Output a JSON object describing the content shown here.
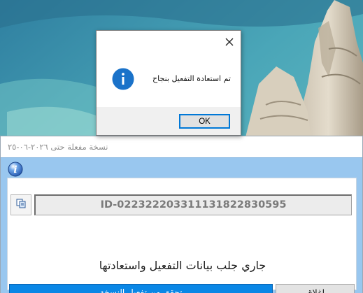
{
  "main_window": {
    "title": "نسخة مفعلة حتى ٢٠٢٦-٠٦-٢٥",
    "machine_id": "ID-022322203311131822830595",
    "status_text": "جاري جلب بيانات التفعيل واستعادتها",
    "verify_button_label": "تحقق من تفعيل النسخة",
    "close_button_label": "إغلاق",
    "accent_color": "#0a87e6",
    "body_color": "#99c7ef"
  },
  "message_box": {
    "message": "تم استعادة التفعيل بنجاح",
    "ok_label": "OK",
    "icon": "info-icon",
    "close_icon": "close-icon"
  },
  "icons": {
    "main_badge": "info-icon",
    "copy": "copy-icon"
  }
}
